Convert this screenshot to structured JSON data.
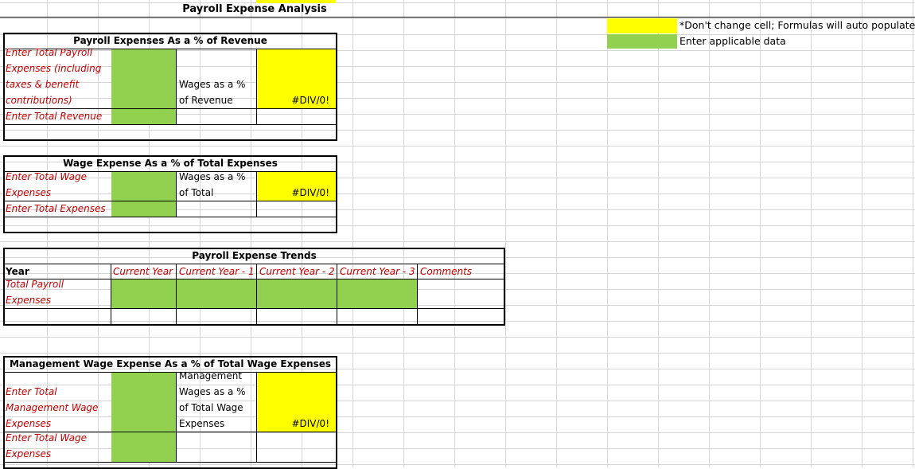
{
  "title": "Payroll Expense Analysis",
  "legend": {
    "yellow_label": "*Don't change cell; Formulas will auto populate",
    "green_label": "Enter applicable data",
    "colors": {
      "yellow": "#ffff00",
      "green": "#92d050"
    }
  },
  "section1": {
    "title": "Payroll Expenses As a % of Revenue",
    "label_payroll_lines": [
      "Enter Total Payroll",
      "Expenses (including",
      "taxes & benefit",
      "contributions)"
    ],
    "label_revenue": "Enter Total Revenue",
    "result_label_lines": [
      "Wages as a %",
      "of Revenue"
    ],
    "result": "#DIV/0!"
  },
  "section2": {
    "title": "Wage Expense As a % of Total Expenses",
    "label_wage_lines": [
      "Enter Total Wage",
      "Expenses"
    ],
    "label_total": "Enter Total Expenses",
    "result_label_lines": [
      "Wages as a %",
      "of Total"
    ],
    "result": "#DIV/0!"
  },
  "section3": {
    "title": "Payroll Expense Trends",
    "row_header": "Year",
    "columns": [
      "Current Year",
      "Current Year - 1",
      "Current Year - 2",
      "Current Year - 3",
      "Comments"
    ],
    "row_label_lines": [
      "Total Payroll",
      "Expenses"
    ]
  },
  "section4": {
    "title": "Management Wage Expense As a % of Total Wage Expenses",
    "label_mgmt_lines": [
      "Enter Total",
      "Management Wage",
      "Expenses"
    ],
    "label_total_lines": [
      "Enter Total Wage",
      "Expenses"
    ],
    "result_label_lines": [
      "Management",
      "Wages as a %",
      "of Total Wage",
      "Expenses"
    ],
    "result": "#DIV/0!"
  }
}
